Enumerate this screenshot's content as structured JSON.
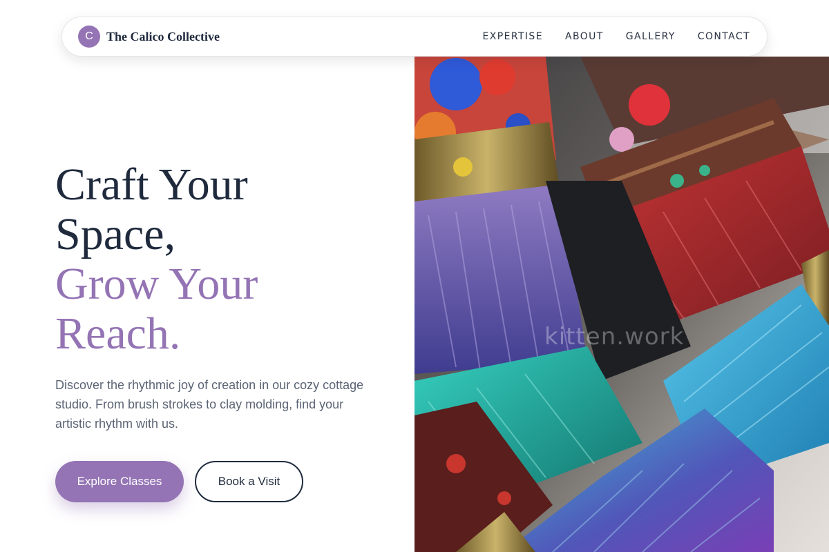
{
  "brand": {
    "mark": "C",
    "name": "The Calico Collective"
  },
  "nav": {
    "links": [
      "EXPERTISE",
      "ABOUT",
      "GALLERY",
      "CONTACT"
    ]
  },
  "hero": {
    "headline_lines": [
      "Craft Your",
      "Space,",
      "Grow Your",
      "Reach."
    ],
    "description": "Discover the rhythmic joy of creation in our cozy cottage studio. From brush strokes to clay molding, find your artistic rhythm with us.",
    "primary_cta": "Explore Classes",
    "secondary_cta": "Book a Visit",
    "image_watermark": "kitten.work"
  },
  "colors": {
    "accent": "#9474b4",
    "text_dark": "#1f2a3d",
    "text_muted": "#5b6474"
  }
}
